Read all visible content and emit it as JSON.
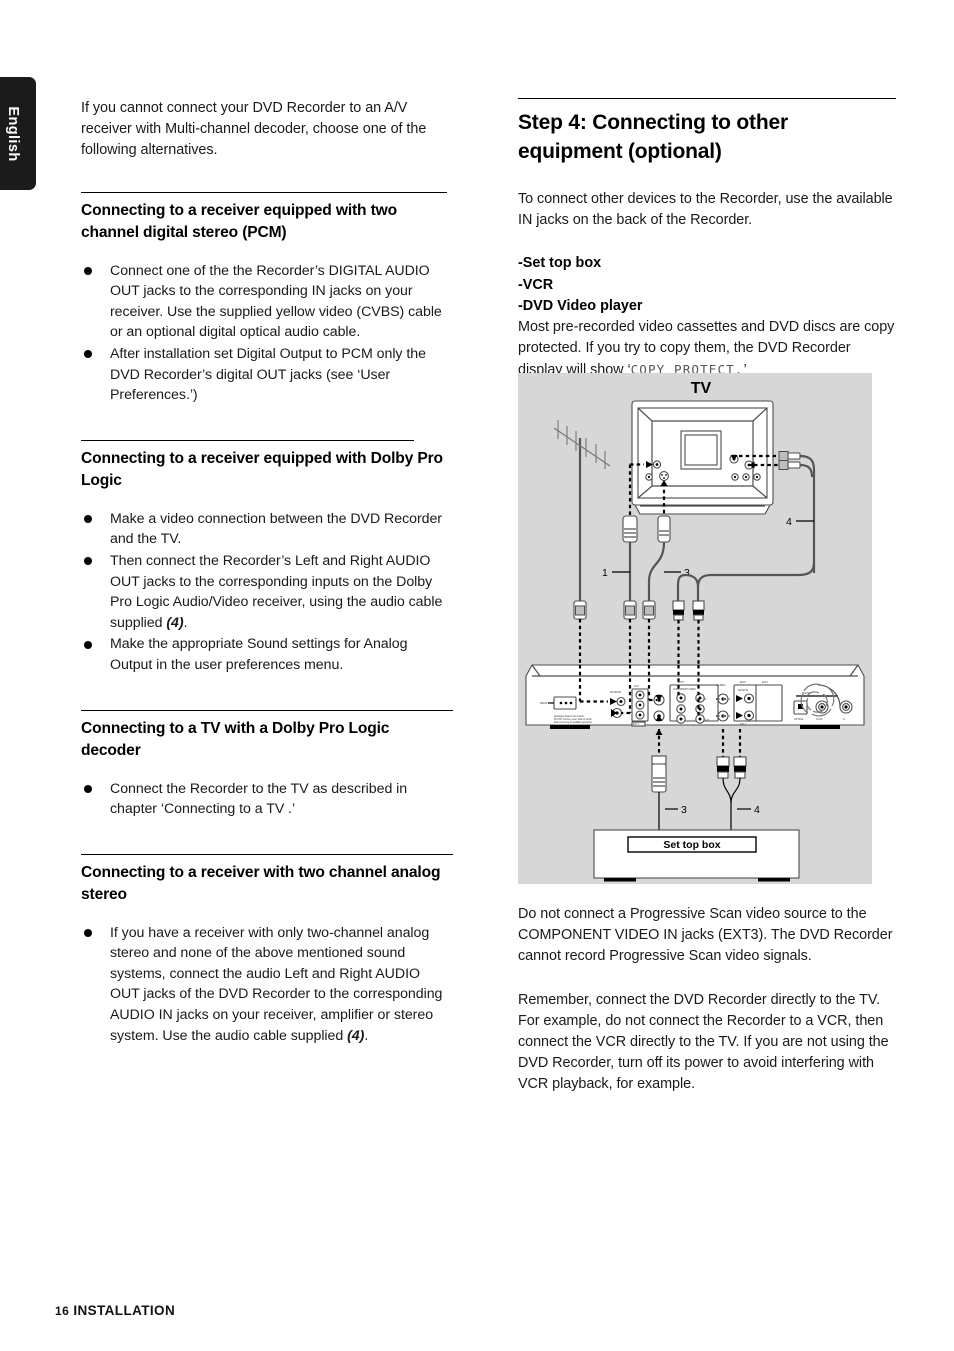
{
  "language_tab": {
    "label": "English"
  },
  "left_column": {
    "intro": "If you cannot connect your DVD Recorder to an A/V receiver with Multi-channel decoder, choose one of the following alternatives.",
    "sections": [
      {
        "heading": "Connecting to a receiver equipped with two channel digital stereo (PCM)",
        "bullets": [
          "Connect one of the the Recorder’s DIGITAL AUDIO OUT jacks to the corresponding IN jacks on your receiver. Use the supplied yellow video (CVBS) cable or an optional digital optical audio cable.",
          "After installation set Digital Output to PCM only the DVD Recorder’s digital OUT jacks (see ‘User Preferences.’)"
        ]
      },
      {
        "heading": "Connecting to a receiver equipped with Dolby Pro Logic",
        "bullets": [
          "Make a video connection between the DVD Recorder and the TV.",
          "Then connect the Recorder’s Left and Right AUDIO OUT jacks to the corresponding inputs on the Dolby Pro Logic Audio/Video receiver, using the audio cable supplied (4).",
          "Make the appropriate Sound settings for Analog Output in the user preferences menu."
        ]
      },
      {
        "heading": "Connecting to a TV with a Dolby Pro Logic decoder",
        "bullets": [
          "Connect the Recorder to the TV as described in chapter ‘Connecting to a TV .’"
        ]
      },
      {
        "heading": "Connecting to a receiver with two channel analog stereo",
        "bullets": [
          "If you have a receiver with only two-channel analog stereo and none of the above mentioned sound systems, connect the audio Left and Right AUDIO OUT jacks of the DVD Recorder to the corresponding AUDIO IN jacks on your receiver, amplifier or stereo system. Use the audio cable supplied (4)."
        ]
      }
    ]
  },
  "right_column": {
    "step_heading": "Step 4: Connecting to other equipment (optional)",
    "step_intro": "To connect other devices to the Recorder, use the available IN jacks on the back of the Recorder.",
    "device_list": [
      "-Set top box",
      "-VCR",
      "-DVD Video player"
    ],
    "copy_protect_paragraph_before": "Most pre-recorded video cassettes and DVD discs are copy protected. If you try to copy them, the DVD Recorder display will show ‘",
    "copy_protect_display": "COPY PROTECT.",
    "copy_protect_paragraph_after": "’",
    "note_1": "Do not connect a Progressive Scan video source to the COMPONENT VIDEO IN jacks (EXT3). The DVD Recorder cannot record Progressive Scan video signals.",
    "note_2": "Remember, connect the DVD Recorder directly to the TV. For example, do not connect the Recorder to a VCR, then connect the VCR directly to the TV. If you are not using the DVD Recorder, turn off its power to avoid interfering with VCR playback, for example."
  },
  "figure": {
    "tv_label": "TV",
    "set_top_box_label": "Set top box",
    "callouts": [
      "1",
      "3",
      "4",
      "3",
      "4"
    ],
    "background_color": "#d7d7d7"
  },
  "footer": {
    "page_number": "16",
    "section_name": "INSTALLATION"
  }
}
